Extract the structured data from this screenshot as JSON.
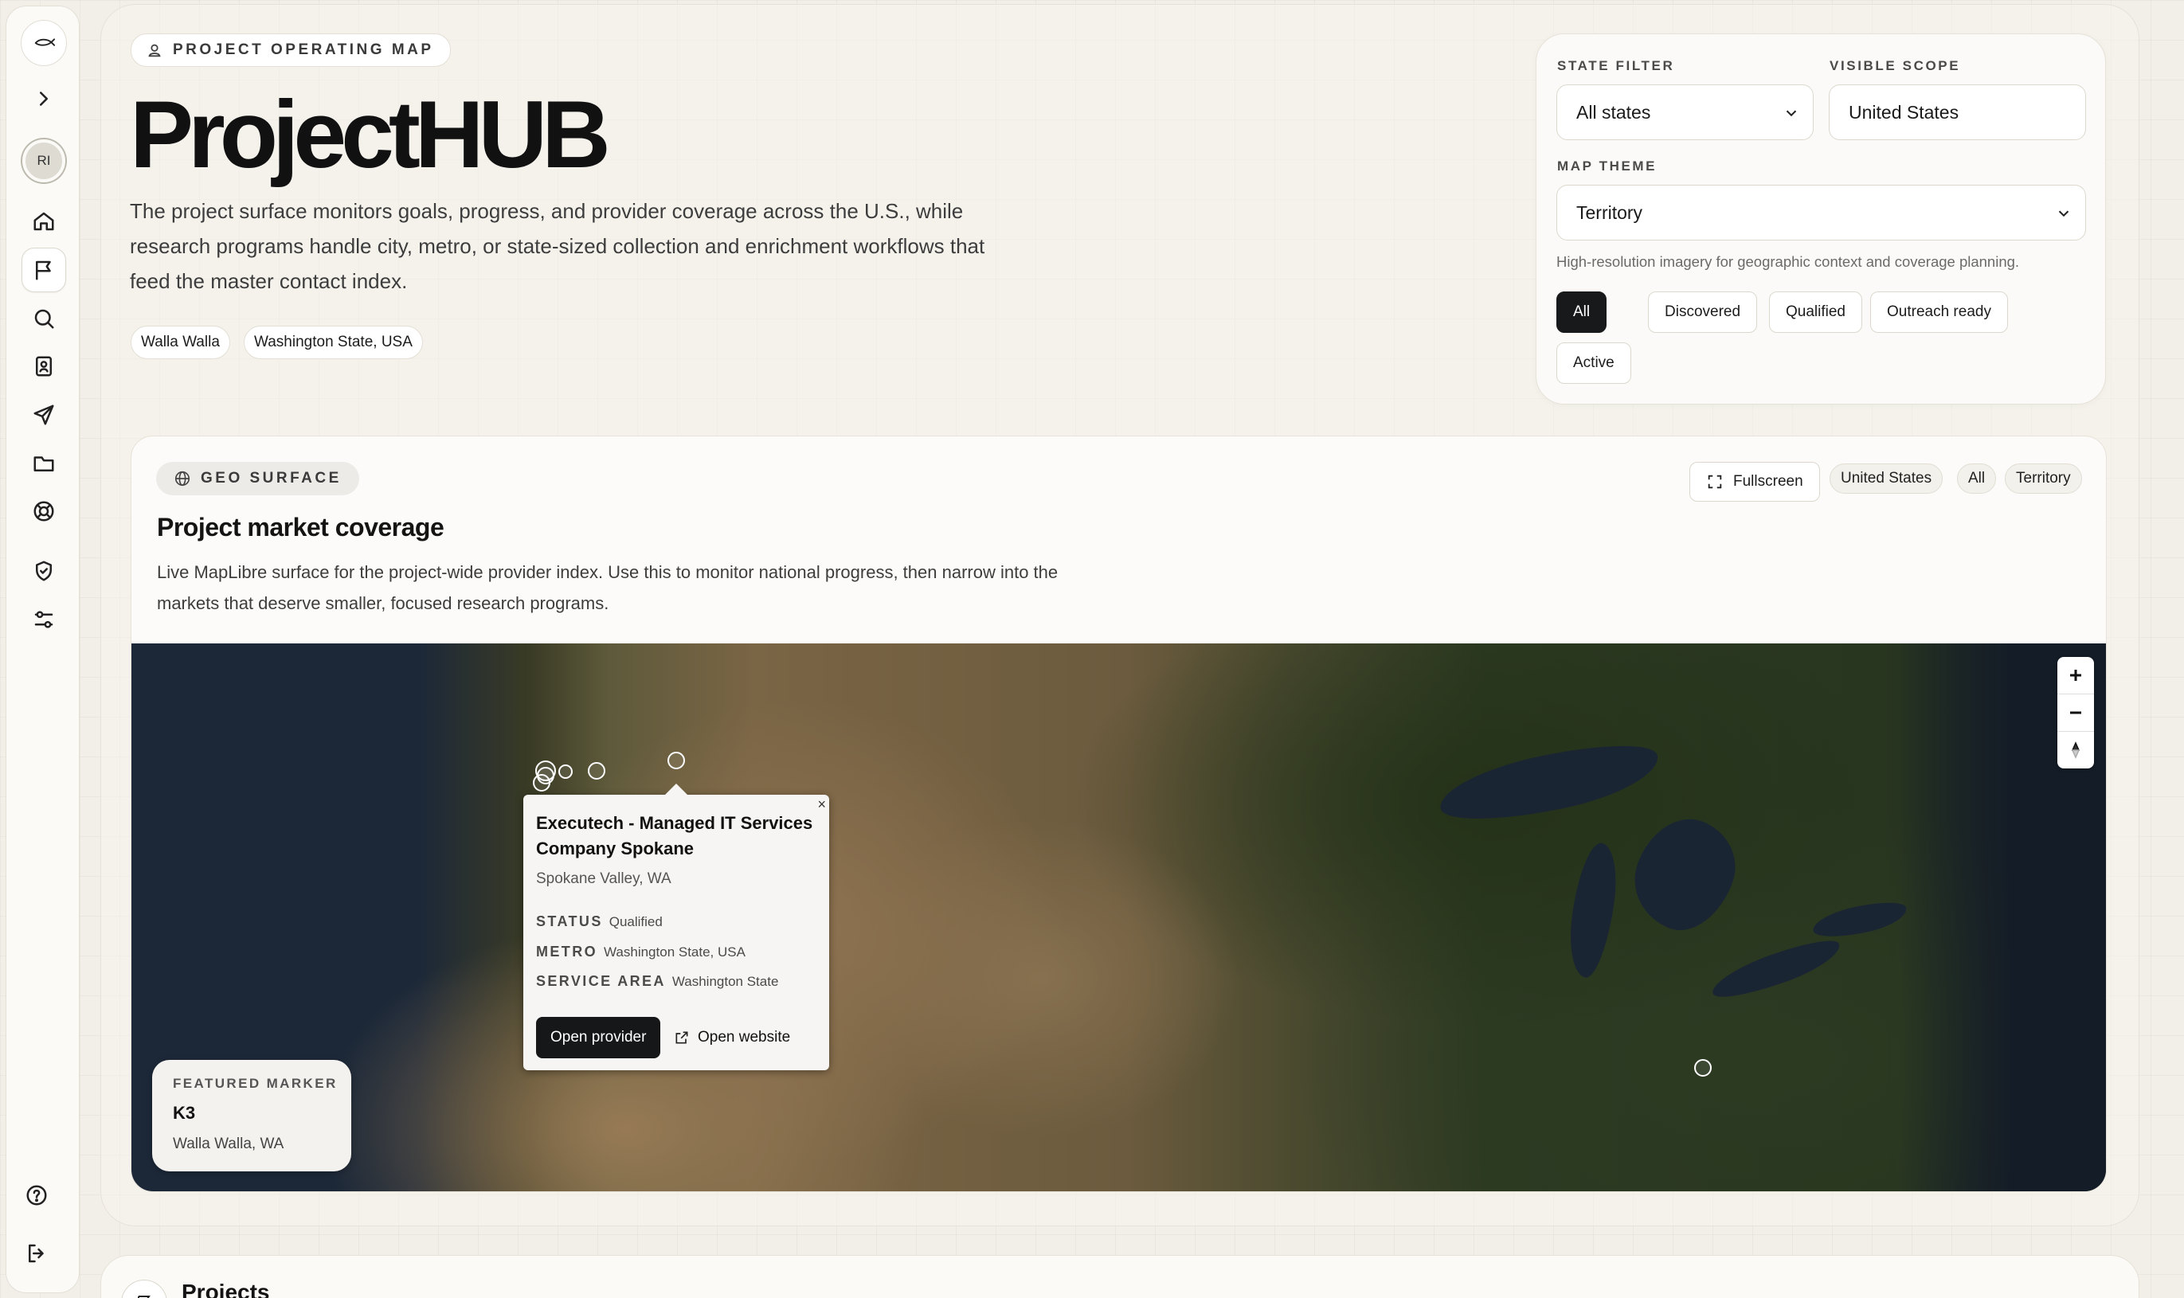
{
  "sidebar": {
    "avatar_initials": "RI",
    "items": [
      {
        "icon": "home-icon"
      },
      {
        "icon": "flag-icon",
        "active": true
      },
      {
        "icon": "search-icon"
      },
      {
        "icon": "contacts-icon"
      },
      {
        "icon": "send-icon"
      },
      {
        "icon": "folder-icon"
      },
      {
        "icon": "lifebuoy-icon"
      },
      {
        "icon": "shield-check-icon"
      },
      {
        "icon": "sliders-icon"
      }
    ],
    "bottom": [
      {
        "icon": "help-icon"
      },
      {
        "icon": "logout-icon"
      }
    ]
  },
  "hero": {
    "tag": "PROJECT OPERATING MAP",
    "title": "ProjectHUB",
    "description": "The project surface monitors goals, progress, and provider coverage across the U.S., while research programs handle city, metro, or state-sized collection and enrichment workflows that feed the master contact index.",
    "chips": [
      "Walla Walla",
      "Washington State, USA"
    ]
  },
  "filters": {
    "state_filter_label": "STATE FILTER",
    "state_filter_value": "All states",
    "visible_scope_label": "VISIBLE SCOPE",
    "visible_scope_value": "United States",
    "map_theme_label": "MAP THEME",
    "map_theme_value": "Territory",
    "hint": "High-resolution imagery for geographic context and coverage planning.",
    "statuses": [
      "All",
      "Discovered",
      "Qualified",
      "Outreach ready",
      "Active"
    ],
    "active_status": "All"
  },
  "geo": {
    "tag": "GEO SURFACE",
    "title": "Project market coverage",
    "description": "Live MapLibre surface for the project-wide provider index. Use this to monitor national progress, then narrow into the markets that deserve smaller, focused research programs.",
    "fullscreen_label": "Fullscreen",
    "scope_chips": [
      "United States",
      "All",
      "Territory"
    ]
  },
  "map": {
    "controls": {
      "zoom_in": "+",
      "zoom_out": "−"
    },
    "popup": {
      "close": "×",
      "title": "Executech - Managed IT Services Company Spokane",
      "location": "Spokane Valley, WA",
      "status_label": "STATUS",
      "status_value": "Qualified",
      "metro_label": "METRO",
      "metro_value": "Washington State, USA",
      "service_area_label": "SERVICE AREA",
      "service_area_value": "Washington State",
      "open_provider": "Open provider",
      "open_website": "Open website"
    },
    "featured": {
      "label": "FEATURED MARKER",
      "name": "K3",
      "city": "Walla Walla, WA"
    }
  },
  "projects": {
    "title": "Projects"
  }
}
